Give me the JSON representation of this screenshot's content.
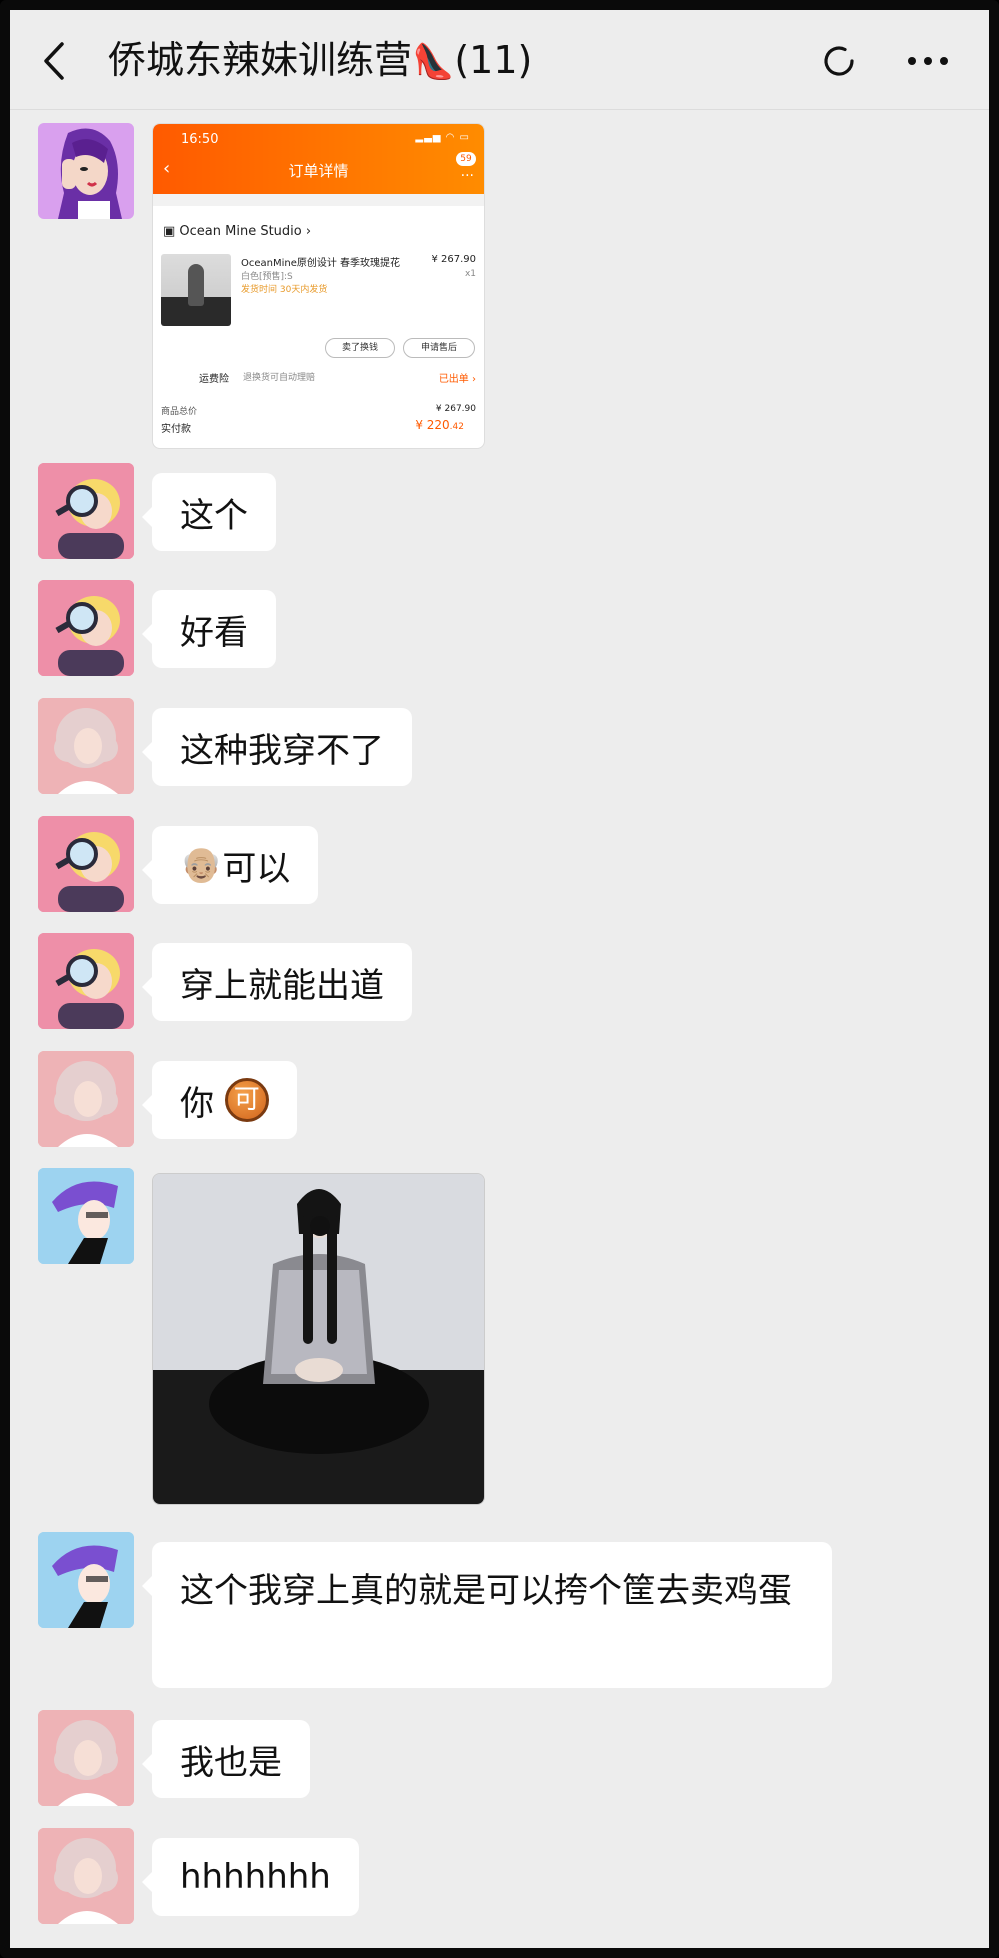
{
  "header": {
    "title": "侨城东辣妹训练营",
    "member_count": "(11)",
    "heel_emoji": "👠"
  },
  "order_card": {
    "time": "16:50",
    "page_title": "订单详情",
    "badge": "59",
    "shop_name": "Ocean Mine Studio",
    "product_name": "OceanMine原创设计 春季玫瑰提花",
    "sku": "白色[预售]:S",
    "ship_note": "发货时间 30天内发货",
    "price": "¥ 267.90",
    "qty": "x1",
    "btn_sell": "卖了换钱",
    "btn_after_sale": "申请售后",
    "fee_label": "运费险",
    "fee_desc": "退换货可自动理赔",
    "fee_status": "已出单",
    "total_label": "商品总价",
    "total_value": "¥ 267.90",
    "paid_label": "实付款",
    "paid_value": "¥ 220",
    "paid_cents": ".42"
  },
  "messages": [
    {
      "text": "这个"
    },
    {
      "text": "好看"
    },
    {
      "text": "这种我穿不了"
    },
    {
      "emoji": "👴🏼",
      "text": "可以"
    },
    {
      "text": "穿上就能出道"
    },
    {
      "text": "你",
      "badge": "可"
    },
    {
      "text": "这个我穿上真的就是可以挎个筐去卖鸡蛋"
    },
    {
      "text": "我也是"
    },
    {
      "text": "hhhhhhh"
    }
  ]
}
